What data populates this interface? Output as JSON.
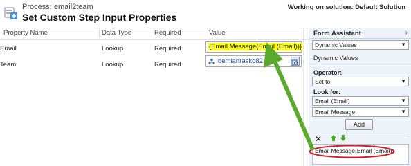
{
  "header": {
    "process_label": "Process: email2team",
    "title": "Set Custom Step Input Properties",
    "solution": "Working on solution: Default Solution"
  },
  "grid": {
    "columns": [
      "Property Name",
      "Data Type",
      "Required",
      "Value"
    ],
    "rows": [
      {
        "name": "Email",
        "type": "Lookup",
        "required": "Required",
        "value": "{Email Message(Email (Email))}"
      },
      {
        "name": "Team",
        "type": "Lookup",
        "required": "Required",
        "value": "demianrasko82"
      }
    ]
  },
  "form_assistant": {
    "title": "Form Assistant",
    "collapse_glyph": "›",
    "mode_select": "Dynamic Values",
    "section_label": "Dynamic Values",
    "operator_label": "Operator:",
    "operator_select": "Set to",
    "look_for_label": "Look for:",
    "entity_select": "Email (Email)",
    "field_select": "Email Message",
    "add_button": "Add",
    "result_text": "Email Message(Email (Email))"
  },
  "colors": {
    "highlight": "#ffff00",
    "arrow": "#5aaa2e",
    "ellipse": "#d0212a",
    "link": "#1a4e9a",
    "panel_bg": "#eef3f9"
  }
}
